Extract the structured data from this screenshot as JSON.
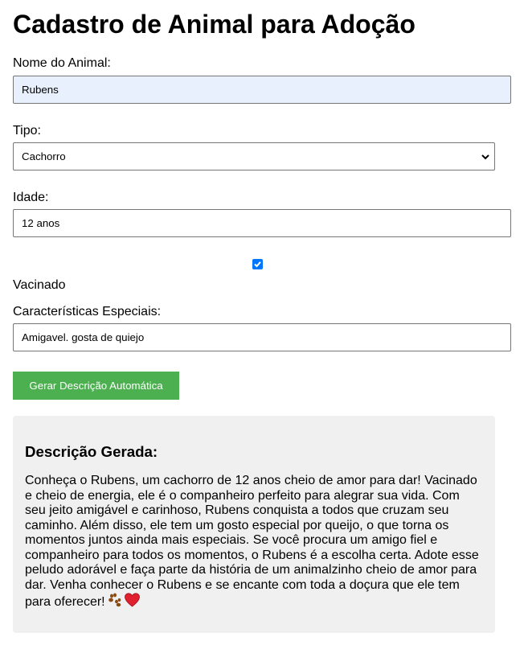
{
  "page": {
    "title": "Cadastro de Animal para Adoção"
  },
  "form": {
    "name_label": "Nome do Animal:",
    "name_value": "Rubens",
    "type_label": "Tipo:",
    "type_value": "Cachorro",
    "age_label": "Idade:",
    "age_value": "12 anos",
    "vaccinated_label": "Vacinado",
    "vaccinated_checked": true,
    "features_label": "Características Especiais:",
    "features_value": "Amigavel. gosta de quiejo",
    "generate_button": "Gerar Descrição Automática"
  },
  "result": {
    "heading": "Descrição Gerada:",
    "text": "Conheça o Rubens, um cachorro de 12 anos cheio de amor para dar! Vacinado e cheio de energia, ele é o companheiro perfeito para alegrar sua vida. Com seu jeito amigável e carinhoso, Rubens conquista a todos que cruzam seu caminho. Além disso, ele tem um gosto especial por queijo, o que torna os momentos juntos ainda mais especiais. Se você procura um amigo fiel e companheiro para todos os momentos, o Rubens é a escolha certa. Adote esse peludo adorável e faça parte da história de um animalzinho cheio de amor para dar. Venha conhecer o Rubens e se encante com toda a doçura que ele tem para oferecer!",
    "emojis": [
      "paw-prints-icon",
      "red-heart-icon"
    ]
  },
  "colors": {
    "button_bg": "#4caf50",
    "autofill_bg": "#e8f0fe",
    "result_bg": "#f0f0f0",
    "checkbox_accent": "#0075ff"
  }
}
